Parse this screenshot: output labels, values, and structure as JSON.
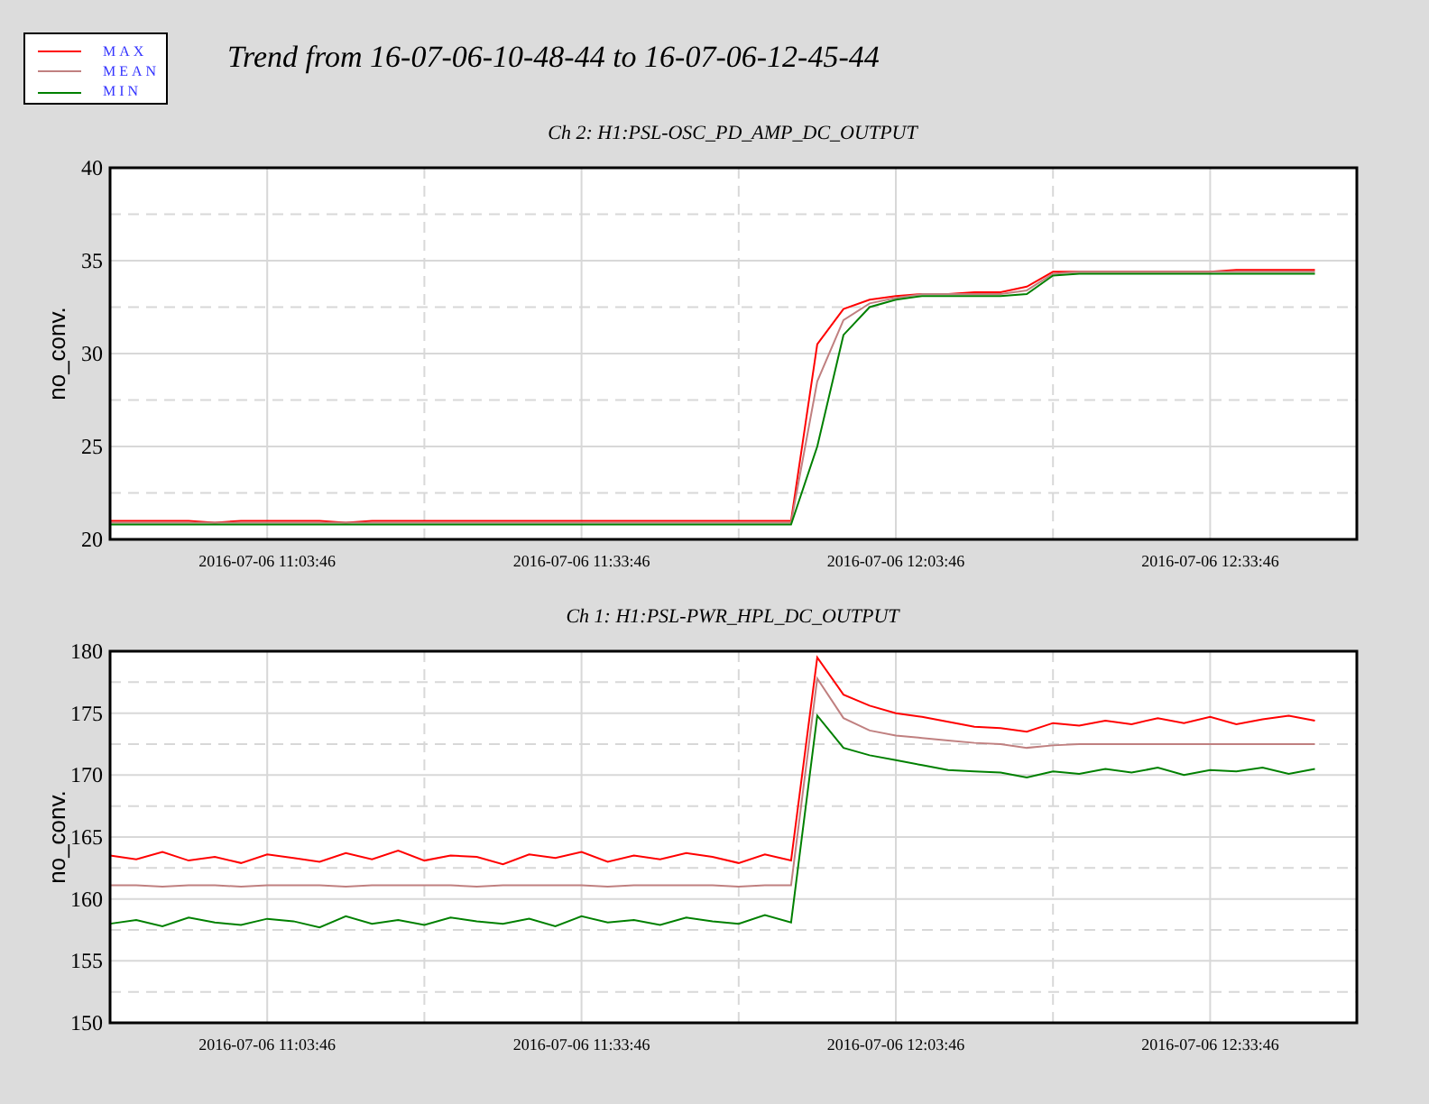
{
  "legend": [
    {
      "label": "MAX",
      "color": "#ff0000"
    },
    {
      "label": "MEAN",
      "color": "#c08080"
    },
    {
      "label": "MIN",
      "color": "#008000"
    }
  ],
  "title": "Trend from 16-07-06-10-48-44 to 16-07-06-12-45-44",
  "charts": [
    {
      "chart_data": {
        "type": "line",
        "title": "Ch 2: H1:PSL-OSC_PD_AMP_DC_OUTPUT",
        "ylabel": "no_conv.",
        "categories": [
          null,
          null,
          null,
          null,
          null,
          null,
          "2016-07-06 11:03:46",
          null,
          null,
          null,
          null,
          null,
          null,
          null,
          null,
          null,
          null,
          null,
          "2016-07-06 11:33:46",
          null,
          null,
          null,
          null,
          null,
          null,
          null,
          null,
          null,
          null,
          null,
          "2016-07-06 12:03:46",
          null,
          null,
          null,
          null,
          null,
          null,
          null,
          null,
          null,
          null,
          null,
          "2016-07-06 12:33:46",
          null,
          null,
          null,
          null
        ],
        "grid": true,
        "ylim": [
          20,
          40
        ],
        "yticks": [
          20,
          25,
          30,
          35,
          40
        ],
        "series": [
          {
            "color": "#ff0000",
            "values": [
              21.0,
              21.0,
              21.0,
              21.0,
              20.9,
              21.0,
              21.0,
              21.0,
              21.0,
              20.9,
              21.0,
              21.0,
              21.0,
              21.0,
              21.0,
              21.0,
              21.0,
              21.0,
              21.0,
              21.0,
              21.0,
              21.0,
              21.0,
              21.0,
              21.0,
              21.0,
              21.0,
              30.5,
              32.4,
              32.9,
              33.1,
              33.2,
              33.2,
              33.3,
              33.3,
              33.6,
              34.4,
              34.4,
              34.4,
              34.4,
              34.4,
              34.4,
              34.4,
              34.5,
              34.5,
              34.5,
              34.5
            ]
          },
          {
            "color": "#c08080",
            "values": [
              20.9,
              20.9,
              20.9,
              20.9,
              20.9,
              20.9,
              20.9,
              20.9,
              20.9,
              20.9,
              20.9,
              20.9,
              20.9,
              20.9,
              20.9,
              20.9,
              20.9,
              20.9,
              20.9,
              20.9,
              20.9,
              20.9,
              20.9,
              20.9,
              20.9,
              20.9,
              20.9,
              28.5,
              31.8,
              32.7,
              33.0,
              33.2,
              33.2,
              33.2,
              33.2,
              33.4,
              34.3,
              34.4,
              34.4,
              34.4,
              34.4,
              34.4,
              34.4,
              34.4,
              34.4,
              34.4,
              34.4
            ]
          },
          {
            "color": "#008000",
            "values": [
              20.8,
              20.8,
              20.8,
              20.8,
              20.8,
              20.8,
              20.8,
              20.8,
              20.8,
              20.8,
              20.8,
              20.8,
              20.8,
              20.8,
              20.8,
              20.8,
              20.8,
              20.8,
              20.8,
              20.8,
              20.8,
              20.8,
              20.8,
              20.8,
              20.8,
              20.8,
              20.8,
              25.0,
              31.0,
              32.5,
              32.9,
              33.1,
              33.1,
              33.1,
              33.1,
              33.2,
              34.2,
              34.3,
              34.3,
              34.3,
              34.3,
              34.3,
              34.3,
              34.3,
              34.3,
              34.3,
              34.3
            ]
          }
        ]
      }
    },
    {
      "chart_data": {
        "type": "line",
        "title": "Ch 1: H1:PSL-PWR_HPL_DC_OUTPUT",
        "ylabel": "no_conv.",
        "categories": [
          null,
          null,
          null,
          null,
          null,
          null,
          "2016-07-06 11:03:46",
          null,
          null,
          null,
          null,
          null,
          null,
          null,
          null,
          null,
          null,
          null,
          "2016-07-06 11:33:46",
          null,
          null,
          null,
          null,
          null,
          null,
          null,
          null,
          null,
          null,
          null,
          "2016-07-06 12:03:46",
          null,
          null,
          null,
          null,
          null,
          null,
          null,
          null,
          null,
          null,
          null,
          "2016-07-06 12:33:46",
          null,
          null,
          null,
          null
        ],
        "grid": true,
        "ylim": [
          150,
          180
        ],
        "yticks": [
          150,
          155,
          160,
          165,
          170,
          175,
          180
        ],
        "series": [
          {
            "color": "#ff0000",
            "values": [
              163.5,
              163.2,
              163.8,
              163.1,
              163.4,
              162.9,
              163.6,
              163.3,
              163.0,
              163.7,
              163.2,
              163.9,
              163.1,
              163.5,
              163.4,
              162.8,
              163.6,
              163.3,
              163.8,
              163.0,
              163.5,
              163.2,
              163.7,
              163.4,
              162.9,
              163.6,
              163.1,
              179.5,
              176.5,
              175.6,
              175.0,
              174.7,
              174.3,
              173.9,
              173.8,
              173.5,
              174.2,
              174.0,
              174.4,
              174.1,
              174.6,
              174.2,
              174.7,
              174.1,
              174.5,
              174.8,
              174.4
            ]
          },
          {
            "color": "#c08080",
            "values": [
              161.1,
              161.1,
              161.0,
              161.1,
              161.1,
              161.0,
              161.1,
              161.1,
              161.1,
              161.0,
              161.1,
              161.1,
              161.1,
              161.1,
              161.0,
              161.1,
              161.1,
              161.1,
              161.1,
              161.0,
              161.1,
              161.1,
              161.1,
              161.1,
              161.0,
              161.1,
              161.1,
              177.8,
              174.6,
              173.6,
              173.2,
              173.0,
              172.8,
              172.6,
              172.5,
              172.2,
              172.4,
              172.5,
              172.5,
              172.5,
              172.5,
              172.5,
              172.5,
              172.5,
              172.5,
              172.5,
              172.5
            ]
          },
          {
            "color": "#008000",
            "values": [
              158.0,
              158.3,
              157.8,
              158.5,
              158.1,
              157.9,
              158.4,
              158.2,
              157.7,
              158.6,
              158.0,
              158.3,
              157.9,
              158.5,
              158.2,
              158.0,
              158.4,
              157.8,
              158.6,
              158.1,
              158.3,
              157.9,
              158.5,
              158.2,
              158.0,
              158.7,
              158.1,
              174.8,
              172.2,
              171.6,
              171.2,
              170.8,
              170.4,
              170.3,
              170.2,
              169.8,
              170.3,
              170.1,
              170.5,
              170.2,
              170.6,
              170.0,
              170.4,
              170.3,
              170.6,
              170.1,
              170.5
            ]
          }
        ]
      }
    }
  ]
}
